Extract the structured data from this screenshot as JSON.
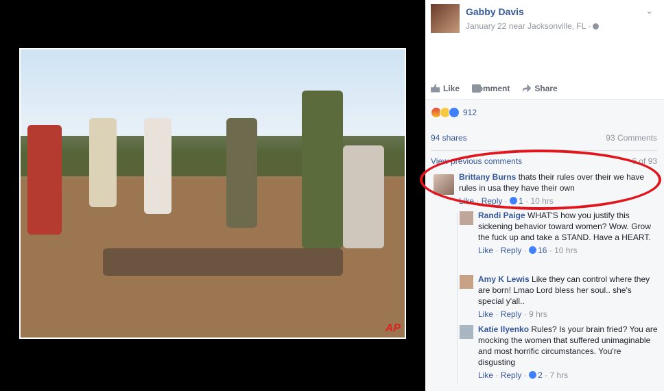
{
  "photo": {
    "watermark": "AP"
  },
  "post": {
    "author": "Gabby Davis",
    "meta": "January 22 near Jacksonville, FL ·"
  },
  "actions": {
    "like": "Like",
    "comment": "Comment",
    "share": "Share"
  },
  "reactions": {
    "count": "912",
    "shares": "94 shares",
    "comments": "93 Comments"
  },
  "view_previous": "View previous comments",
  "page_count": "6 of 93",
  "comments": [
    {
      "name": "Brittany Burns",
      "text": "thats their rules over their we have rules in usa they have their own",
      "like": "Like",
      "reply": "Reply",
      "likes": "1",
      "time": "10 hrs"
    },
    {
      "name": "Randi Paige",
      "text": "WHAT'S how you justify this sickening behavior toward women? Wow. Grow the fuck up and take a STAND. Have a HEART.",
      "like": "Like",
      "reply": "Reply",
      "likes": "16",
      "time": "10 hrs"
    },
    {
      "name": "Amy K Lewis",
      "text": "Like they can control where they are born! Lmao Lord bless her soul.. she's special y'all..",
      "like": "Like",
      "reply": "Reply",
      "time": "9 hrs"
    },
    {
      "name": "Katie Ilyenko",
      "text": "Rules? Is your brain fried? You are mocking the women that suffered unimaginable and most horrific circumstances. You're disgusting",
      "like": "Like",
      "reply": "Reply",
      "likes": "2",
      "time": "7 hrs"
    }
  ],
  "colors": {
    "link": "#365899",
    "highlight": "#e0161c",
    "muted": "#90949c"
  }
}
